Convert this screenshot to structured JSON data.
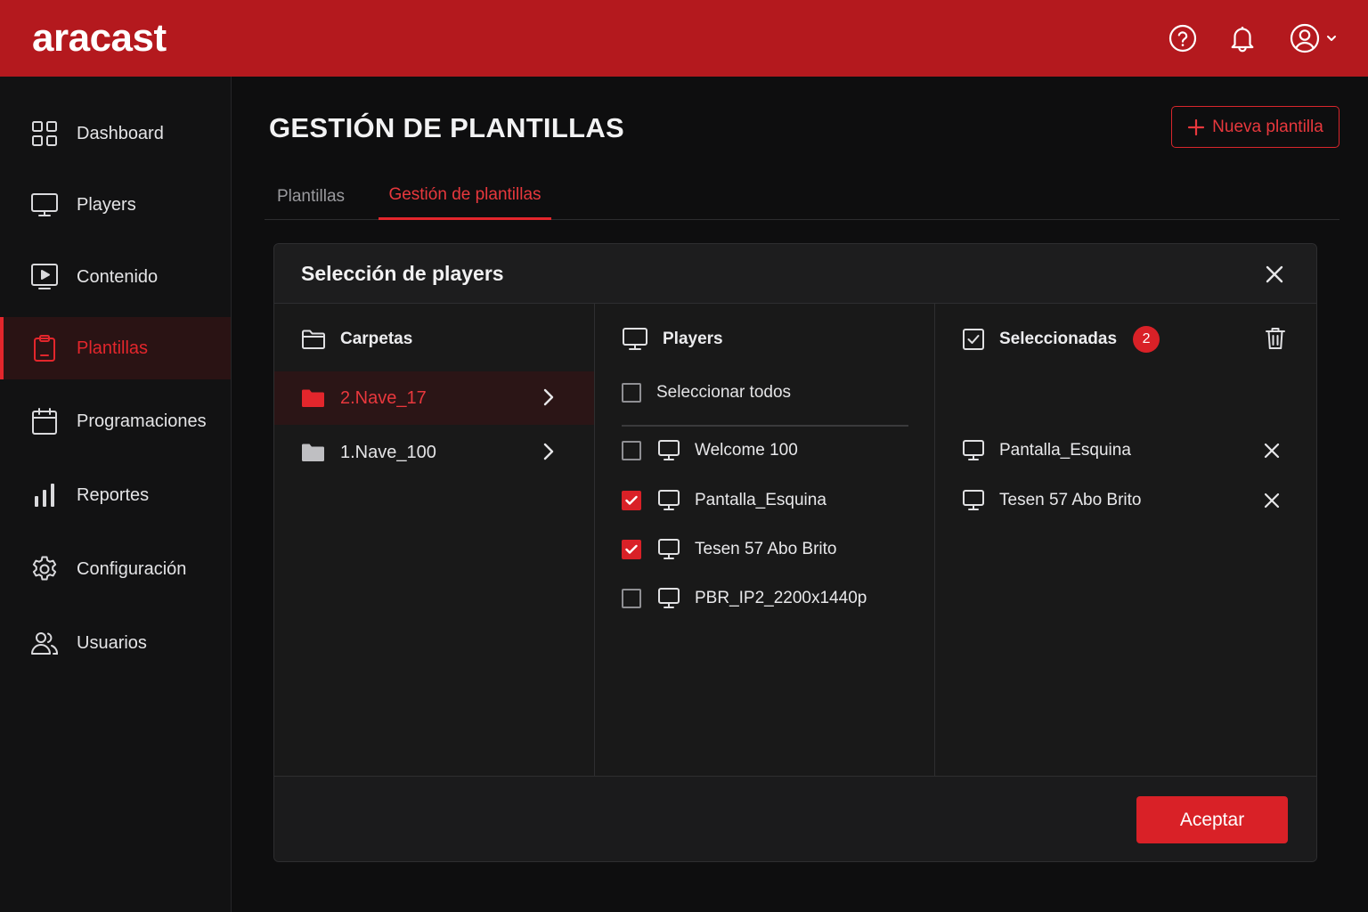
{
  "app": {
    "logo": "aracast"
  },
  "header": {
    "help_icon": "help-circle-icon",
    "bell_icon": "bell-icon",
    "user_icon": "user-circle-icon"
  },
  "sidebar": {
    "items": [
      {
        "label": "Dashboard",
        "icon": "grid-icon"
      },
      {
        "label": "Players",
        "icon": "monitor-icon"
      },
      {
        "label": "Contenido",
        "icon": "play-square-icon"
      },
      {
        "label": "Plantillas",
        "icon": "clipboard-icon",
        "active": true
      },
      {
        "label": "Programaciones",
        "icon": "calendar-icon"
      },
      {
        "label": "Reportes",
        "icon": "bar-chart-icon"
      },
      {
        "label": "Configuración",
        "icon": "gear-icon"
      },
      {
        "label": "Usuarios",
        "icon": "users-icon"
      }
    ]
  },
  "page": {
    "title": "GESTIÓN DE PLANTILLAS",
    "new_button": "Nueva plantilla",
    "tabs": [
      {
        "label": "Plantillas",
        "active": false
      },
      {
        "label": "Gestión de plantillas",
        "active": true
      }
    ]
  },
  "modal": {
    "title": "Selección de players",
    "folders": {
      "header": "Carpetas",
      "items": [
        {
          "label": "2.Nave_17",
          "selected": true
        },
        {
          "label": "1.Nave_100",
          "selected": false
        }
      ]
    },
    "players": {
      "header": "Players",
      "select_all": "Seleccionar todos",
      "items": [
        {
          "label": "Welcome 100",
          "checked": false
        },
        {
          "label": "Pantalla_Esquina",
          "checked": true
        },
        {
          "label": "Tesen 57 Abo Brito",
          "checked": true
        },
        {
          "label": "PBR_IP2_2200x1440p",
          "checked": false
        }
      ]
    },
    "selected": {
      "header": "Seleccionadas",
      "count": "2",
      "items": [
        {
          "label": "Pantalla_Esquina"
        },
        {
          "label": "Tesen 57 Abo Brito"
        }
      ]
    },
    "accept_button": "Aceptar"
  },
  "colors": {
    "brand": "#b4191e",
    "accent": "#e3262c",
    "background": "#0e0e0f"
  }
}
